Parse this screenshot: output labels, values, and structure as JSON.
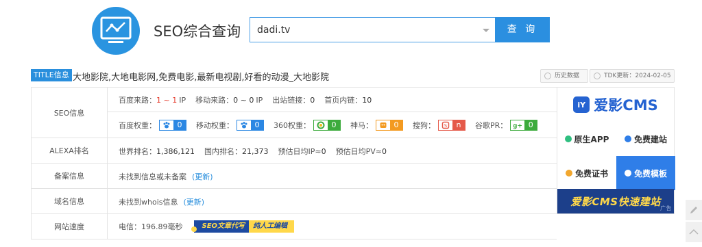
{
  "header": {
    "title": "SEO综合查询",
    "search_value": "dadi.tv",
    "search_button": "查 询"
  },
  "title_row": {
    "badge": "TITLE信息",
    "text": "大地影院,大地电影网,免费电影,最新电视剧,好看的动漫_大地影院",
    "history_button": "历史数据",
    "tdk_button": "TDK更新：2024-02-05"
  },
  "seo": {
    "label": "SEO信息",
    "baidu_source_label": "百度来路：",
    "baidu_source_value": "1 ~ 1",
    "baidu_source_unit": "IP",
    "mobile_source_label": "移动来路：",
    "mobile_source_value": "0 ~ 0",
    "mobile_source_unit": "IP",
    "outbound_label": "出站链接：",
    "outbound_value": "0",
    "internal_label": "首页内链：",
    "internal_value": "10",
    "baidu_weight_label": "百度权重：",
    "baidu_weight_value": "0",
    "mobile_weight_label": "移动权重：",
    "mobile_weight_value": "0",
    "weight360_label": "360权重：",
    "weight360_value": "0",
    "shenma_label": "神马：",
    "shenma_value": "0",
    "sogou_label": "搜狗：",
    "sogou_value": "n",
    "google_label": "谷歌PR：",
    "google_value": "0"
  },
  "alexa": {
    "label": "ALEXA排名",
    "world_label": "世界排名：",
    "world_value": "1,386,121",
    "domestic_label": "国内排名：",
    "domestic_value": "21,373",
    "ip_label": "预估日均IP≈",
    "ip_value": "0",
    "pv_label": "预估日均PV≈",
    "pv_value": "0"
  },
  "beian": {
    "label": "备案信息",
    "text": "未找到信息或未备案",
    "update": "(更新)"
  },
  "domain": {
    "label": "域名信息",
    "text": "未找到whois信息",
    "update": "(更新)"
  },
  "speed": {
    "label": "网站速度",
    "text": "电信：196.89毫秒",
    "promo_a": "SEO文章代写",
    "promo_b": "纯人工编辑"
  },
  "ad": {
    "logo_mark": "iY",
    "logo_text": "爱影CMS",
    "native_app": "原生APP",
    "free_site": "免费建站",
    "free_cert": "免费证书",
    "free_template": "免费模板",
    "banner": "爱影CMS快速建站",
    "tag": "广告"
  },
  "colors": {
    "accent": "#2b8fe0",
    "red": "#e53b2c",
    "green": "#3cab3c",
    "orange": "#f39a20"
  }
}
